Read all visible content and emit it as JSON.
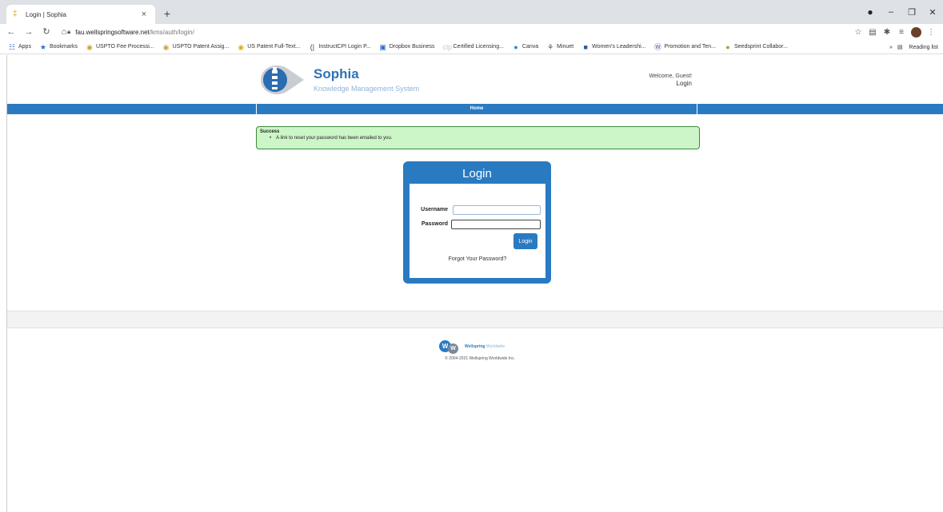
{
  "browser": {
    "tab_title": "Login | Sophia",
    "tab_close": "×",
    "new_tab": "+",
    "url_host": "fau.wellspringsoftware.net",
    "url_path": "/kms/auth/login/",
    "bookmarks": [
      {
        "icon": "apps-icon",
        "glyph": "☷",
        "color": "#4a7bd8",
        "label": "Apps"
      },
      {
        "icon": "star-icon",
        "glyph": "★",
        "color": "#2b6cd4",
        "label": "Bookmarks"
      },
      {
        "icon": "pin-icon",
        "glyph": "◉",
        "color": "#c8a23a",
        "label": "USPTO Fee Processi..."
      },
      {
        "icon": "pin-icon",
        "glyph": "◉",
        "color": "#c8a23a",
        "label": "USPTO Patent Assig..."
      },
      {
        "icon": "pin-icon",
        "glyph": "◉",
        "color": "#d8b020",
        "label": "US Patent Full-Text..."
      },
      {
        "icon": "instructcpi-icon",
        "glyph": "(|",
        "color": "#444444",
        "label": "InstructCPI Login P..."
      },
      {
        "icon": "dropbox-icon",
        "glyph": "▣",
        "color": "#2b6cd4",
        "label": "Dropbox Business"
      },
      {
        "icon": "clp-icon",
        "glyph": "clp",
        "color": "#c8c8c8",
        "label": "Certified Licensing..."
      },
      {
        "icon": "canva-icon",
        "glyph": "●",
        "color": "#2b84d8",
        "label": "Canva"
      },
      {
        "icon": "minuet-icon",
        "glyph": "⚘",
        "color": "#555555",
        "label": "Minuet"
      },
      {
        "icon": "women-leadership-icon",
        "glyph": "■",
        "color": "#2a5aa0",
        "label": "Women's Leadershi..."
      },
      {
        "icon": "wordpress-icon",
        "glyph": "Ⓦ",
        "color": "#4a5a8a",
        "label": "Promotion and Ten..."
      },
      {
        "icon": "seedspring-icon",
        "glyph": "●",
        "color": "#8ab040",
        "label": "Seedsprint Collabor..."
      }
    ],
    "more_bookmarks": "»",
    "reading_list": "Reading list"
  },
  "header": {
    "app_name": "Sophia",
    "app_subtitle": "Knowledge Management System",
    "welcome": "Welcome, Guest!",
    "login_link": "Login"
  },
  "nav": {
    "home": "Home"
  },
  "alert": {
    "title": "Success",
    "message": "A link to reset your password has been emailed to you."
  },
  "login": {
    "title": "Login",
    "username_label": "Username",
    "username_value": "",
    "password_label": "Password",
    "password_value": "",
    "submit_label": "Login",
    "forgot_link": "Forgot Your Password?"
  },
  "footer": {
    "brand_main": "Wellspring",
    "brand_sub": "Worldwide",
    "copyright": "© 2004-2021 Wellspring Worldwide Inc."
  },
  "colors": {
    "brand_blue": "#2a7ac2",
    "success_bg": "#ccf5c8",
    "success_border": "#3c8a3c"
  }
}
